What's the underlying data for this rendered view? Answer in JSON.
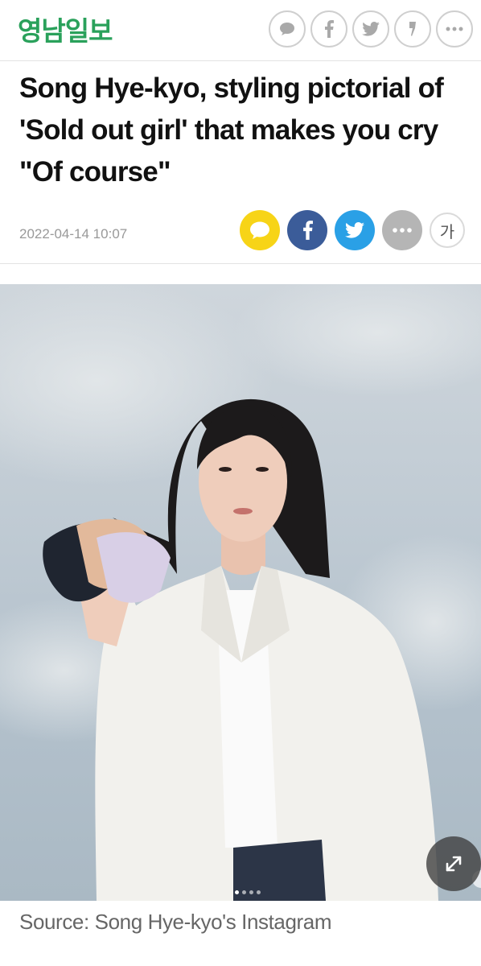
{
  "header": {
    "logo_text": "영남일보",
    "icons": [
      "speech-bubble-icon",
      "facebook-icon",
      "twitter-icon",
      "bookmark-icon",
      "more-icon"
    ]
  },
  "article": {
    "title": "Song Hye-kyo, styling pictorial of 'Sold out girl' that makes you cry \"Of course\"",
    "date": "2022-04-14 10:07",
    "share": {
      "icons": [
        "kakao-icon",
        "facebook-icon",
        "twitter-icon",
        "more-icon"
      ],
      "font_size_label": "가"
    },
    "photo": {
      "carousel_dots": 4,
      "active_dot": 1,
      "caption": "Source: Song Hye-kyo's Instagram"
    }
  },
  "colors": {
    "brand": "#2aa15b",
    "kakao": "#f7d417",
    "facebook": "#3b5c99",
    "twitter": "#2aa0e6"
  }
}
